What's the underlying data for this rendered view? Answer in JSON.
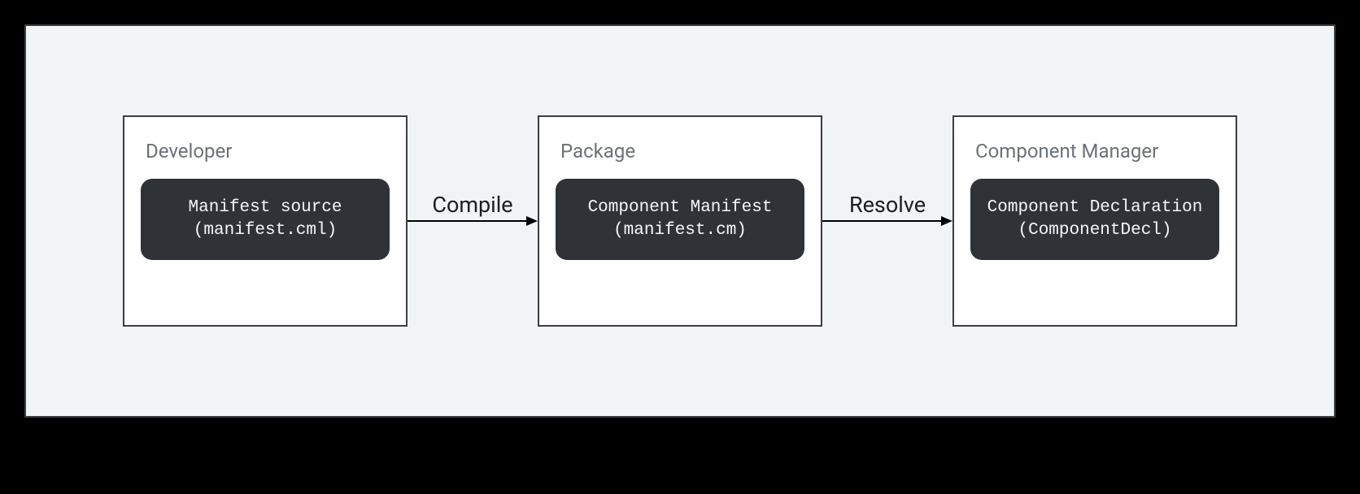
{
  "stages": [
    {
      "title": "Developer",
      "pill_line1": "Manifest source",
      "pill_line2": "(manifest.cml)"
    },
    {
      "title": "Package",
      "pill_line1": "Component Manifest",
      "pill_line2": "(manifest.cm)"
    },
    {
      "title": "Component Manager",
      "pill_line1": "Component Declaration",
      "pill_line2": "(ComponentDecl)"
    }
  ],
  "connectors": [
    {
      "label": "Compile"
    },
    {
      "label": "Resolve"
    }
  ]
}
